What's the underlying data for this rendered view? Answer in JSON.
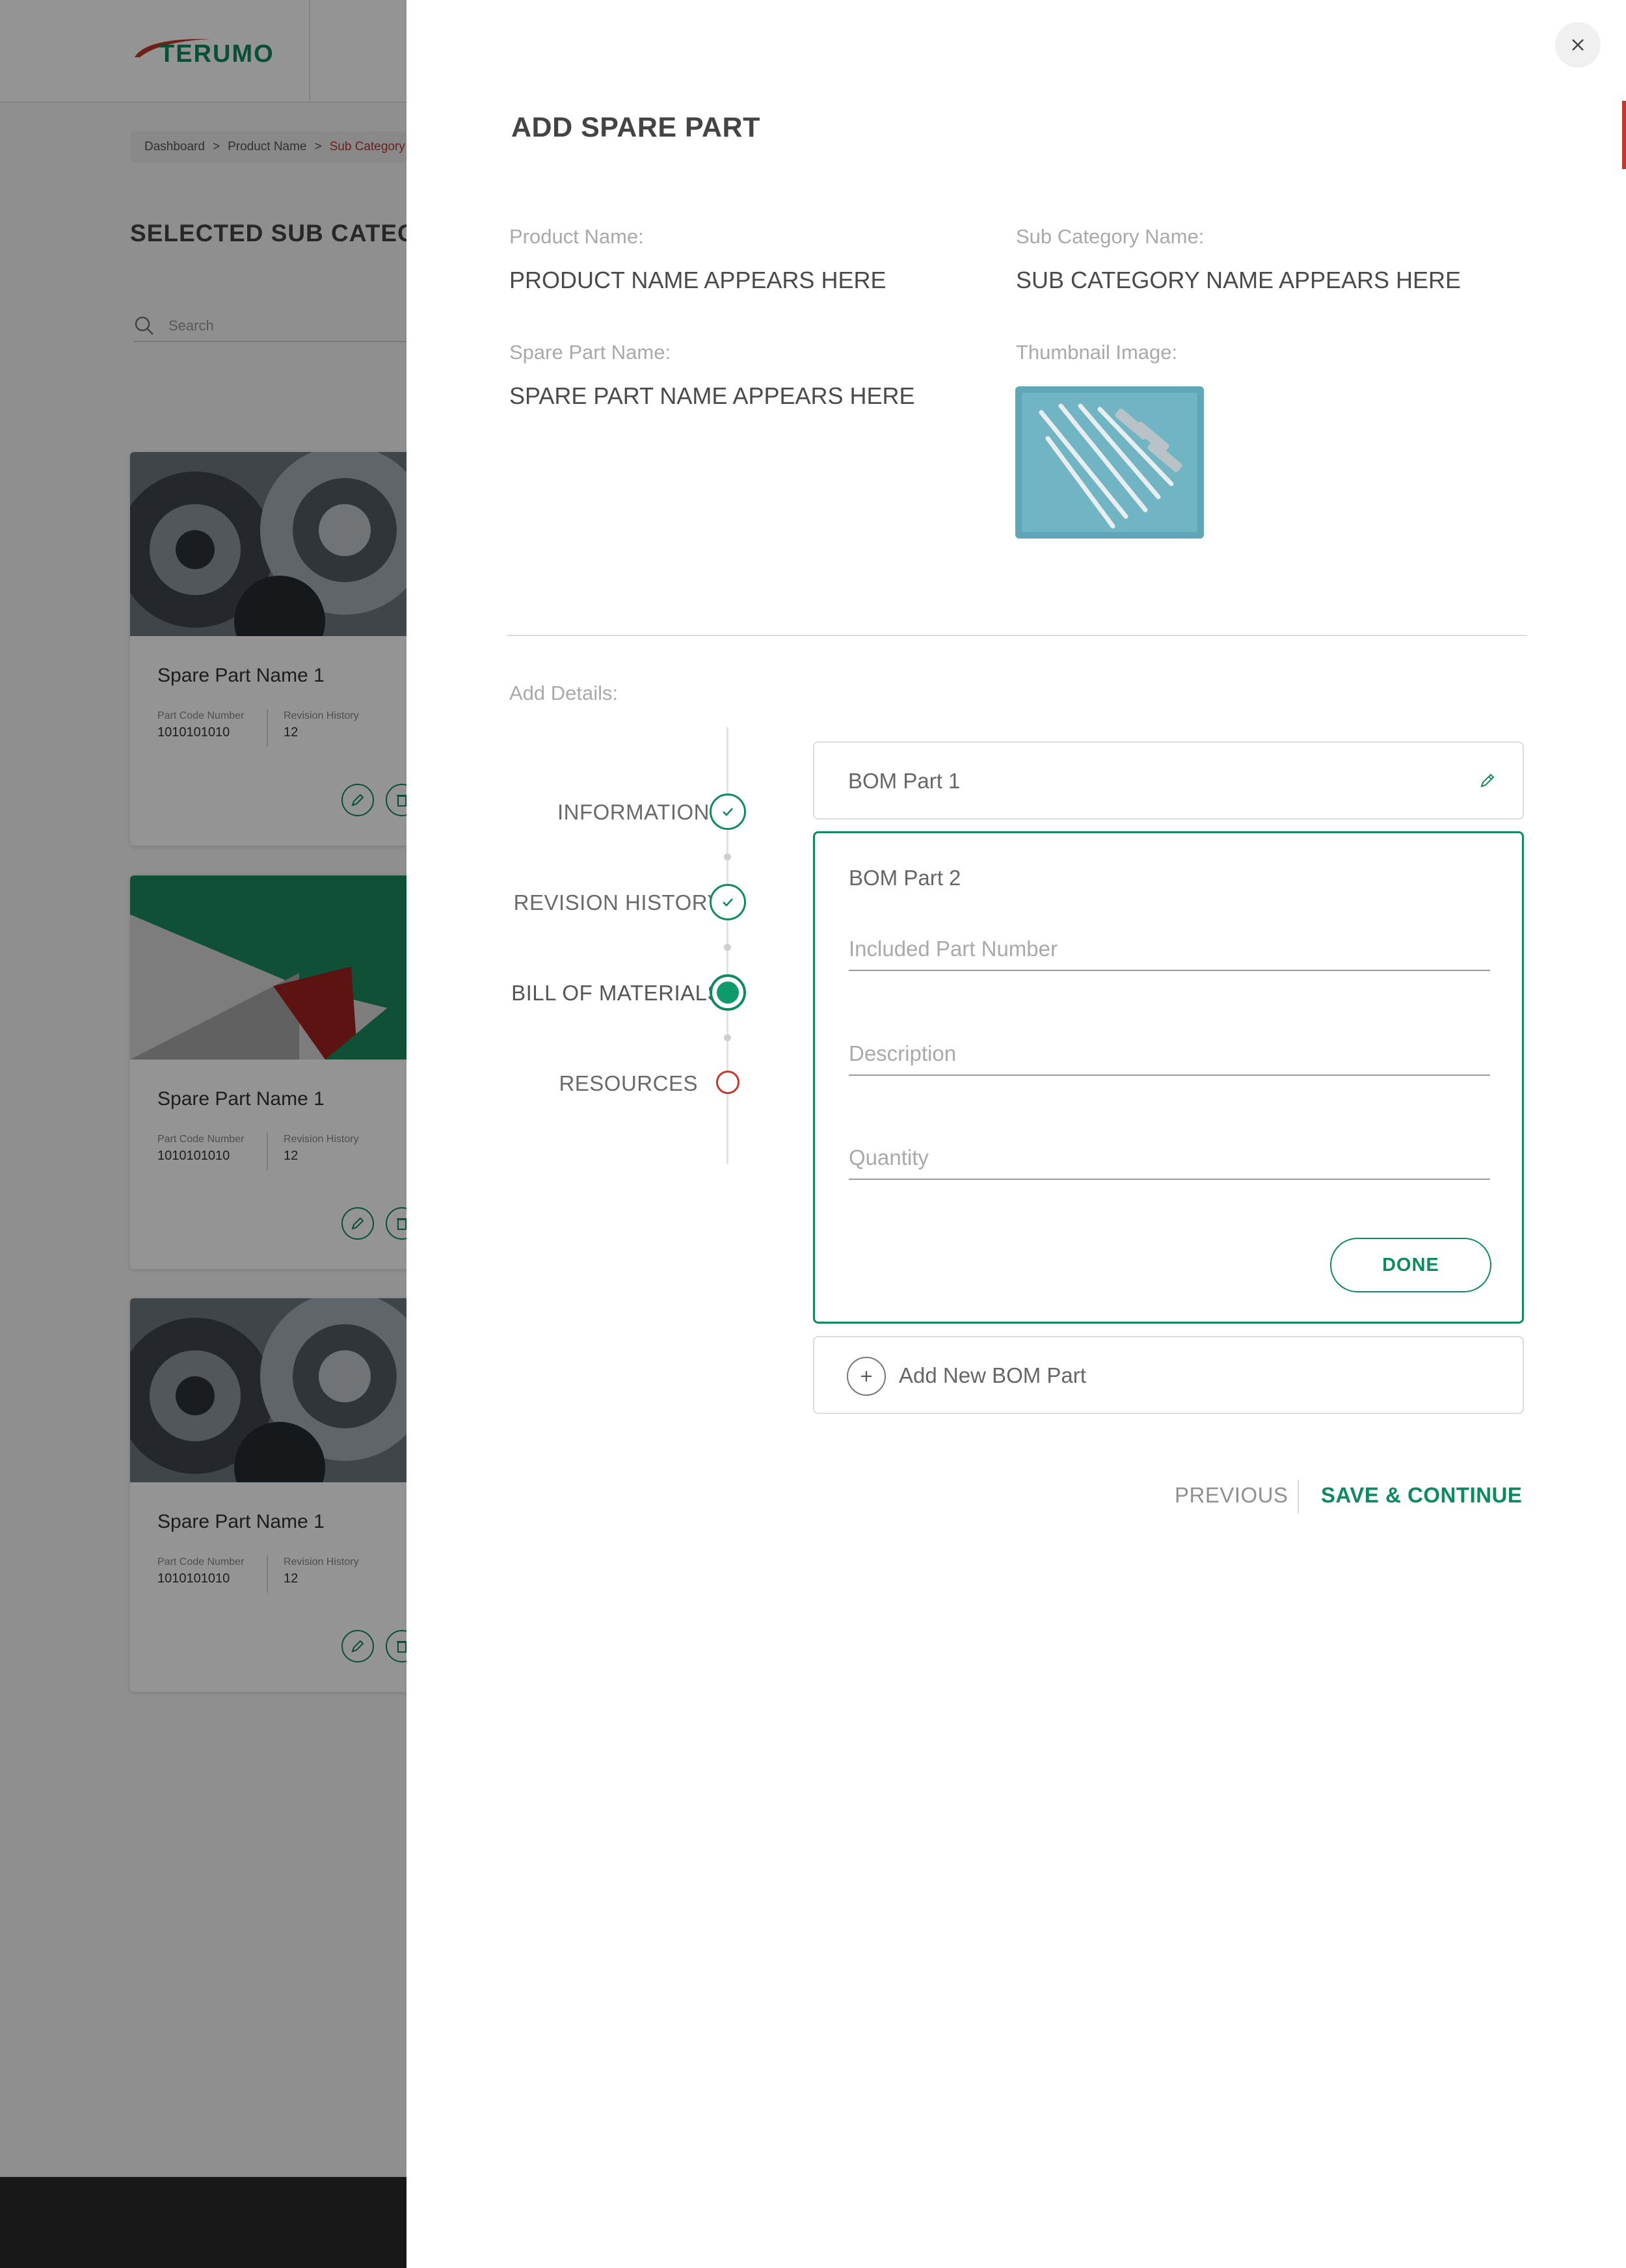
{
  "app": {
    "brand": "TERUMO"
  },
  "colors": {
    "brand_green": "#0e8a5c",
    "accent_red": "#c0392b"
  },
  "breadcrumb": [
    {
      "label": "Dashboard"
    },
    {
      "label": "Product Name"
    },
    {
      "label": "Sub Category N"
    }
  ],
  "breadcrumb_sep": ">",
  "background_page": {
    "title": "SELECTED SUB CATEGOR",
    "search_placeholder": "Search",
    "cards": [
      {
        "name": "Spare Part Name 1",
        "part_code_label": "Part Code Number",
        "part_code": "1010101010",
        "revision_label": "Revision History",
        "revision": "12",
        "image": "gears"
      },
      {
        "name": "Spare Part Name 1",
        "part_code_label": "Part Code Number",
        "part_code": "1010101010",
        "revision_label": "Revision History",
        "revision": "12",
        "image": "green-red-graphic"
      },
      {
        "name": "Spare Part Name 1",
        "part_code_label": "Part Code Number",
        "part_code": "1010101010",
        "revision_label": "Revision History",
        "revision": "12",
        "image": "gears"
      }
    ]
  },
  "drawer": {
    "title": "ADD SPARE PART",
    "close_icon": "close-icon",
    "product_name_label": "Product Name:",
    "product_name": "PRODUCT NAME APPEARS HERE",
    "sub_category_label": "Sub Category Name:",
    "sub_category": "SUB CATEGORY NAME APPEARS HERE",
    "spare_part_label": "Spare Part Name:",
    "spare_part": "SPARE PART NAME APPEARS HERE",
    "thumbnail_label": "Thumbnail Image:",
    "add_details_label": "Add Details:",
    "steps": [
      {
        "label": "INFORMATION",
        "status": "done"
      },
      {
        "label": "REVISION HISTORY",
        "status": "done"
      },
      {
        "label": "BILL OF MATERIALS",
        "status": "current"
      },
      {
        "label": "RESOURCES",
        "status": "todo"
      }
    ],
    "bom_parts": [
      {
        "title": "BOM Part 1",
        "state": "collapsed"
      },
      {
        "title": "BOM Part 2",
        "state": "editing"
      }
    ],
    "fields": {
      "included_part_number": {
        "placeholder": "Included Part Number",
        "value": ""
      },
      "description": {
        "placeholder": "Description",
        "value": ""
      },
      "quantity": {
        "placeholder": "Quantity",
        "value": ""
      }
    },
    "done_label": "DONE",
    "add_new_bom_label": "Add New BOM Part",
    "previous_label": "PREVIOUS",
    "save_continue_label": "SAVE & CONTINUE"
  }
}
